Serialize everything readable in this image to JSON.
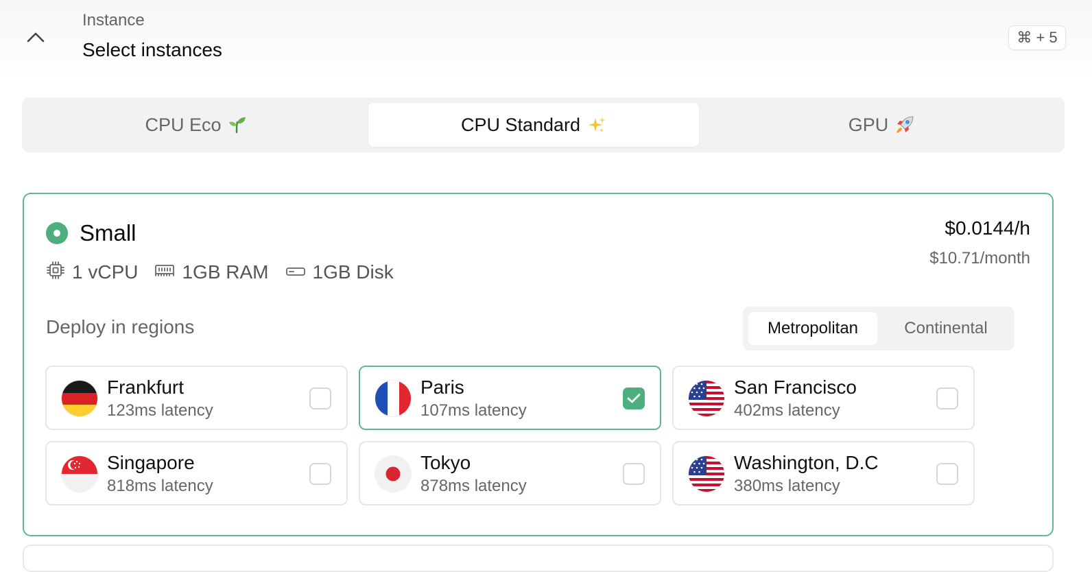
{
  "header": {
    "subtitle": "Instance",
    "title": "Select instances",
    "shortcut": "⌘ + 5",
    "toggle_icon": "chevron-up-icon"
  },
  "tabs": [
    {
      "label": "CPU Eco",
      "icon": "seedling-icon",
      "active": false
    },
    {
      "label": "CPU Standard",
      "icon": "sparkles-icon",
      "active": true
    },
    {
      "label": "GPU",
      "icon": "rocket-icon",
      "active": false
    }
  ],
  "plan": {
    "name": "Small",
    "price_hour": "$0.0144/h",
    "price_month": "$10.71/month",
    "specs": {
      "cpu": "1 vCPU",
      "ram": "1GB RAM",
      "disk": "1GB Disk"
    },
    "deploy_label": "Deploy in regions",
    "region_modes": [
      {
        "label": "Metropolitan",
        "active": true
      },
      {
        "label": "Continental",
        "active": false
      }
    ],
    "regions": [
      {
        "name": "Frankfurt",
        "latency": "123ms latency",
        "flag": "germany-flag-icon",
        "checked": false
      },
      {
        "name": "Paris",
        "latency": "107ms latency",
        "flag": "france-flag-icon",
        "checked": true
      },
      {
        "name": "San Francisco",
        "latency": "402ms latency",
        "flag": "usa-flag-icon",
        "checked": false
      },
      {
        "name": "Singapore",
        "latency": "818ms latency",
        "flag": "singapore-flag-icon",
        "checked": false
      },
      {
        "name": "Tokyo",
        "latency": "878ms latency",
        "flag": "japan-flag-icon",
        "checked": false
      },
      {
        "name": "Washington, D.C",
        "latency": "380ms latency",
        "flag": "usa-flag-icon",
        "checked": false
      }
    ]
  },
  "colors": {
    "accent": "#4caf7d",
    "card_border": "#5fb889"
  }
}
